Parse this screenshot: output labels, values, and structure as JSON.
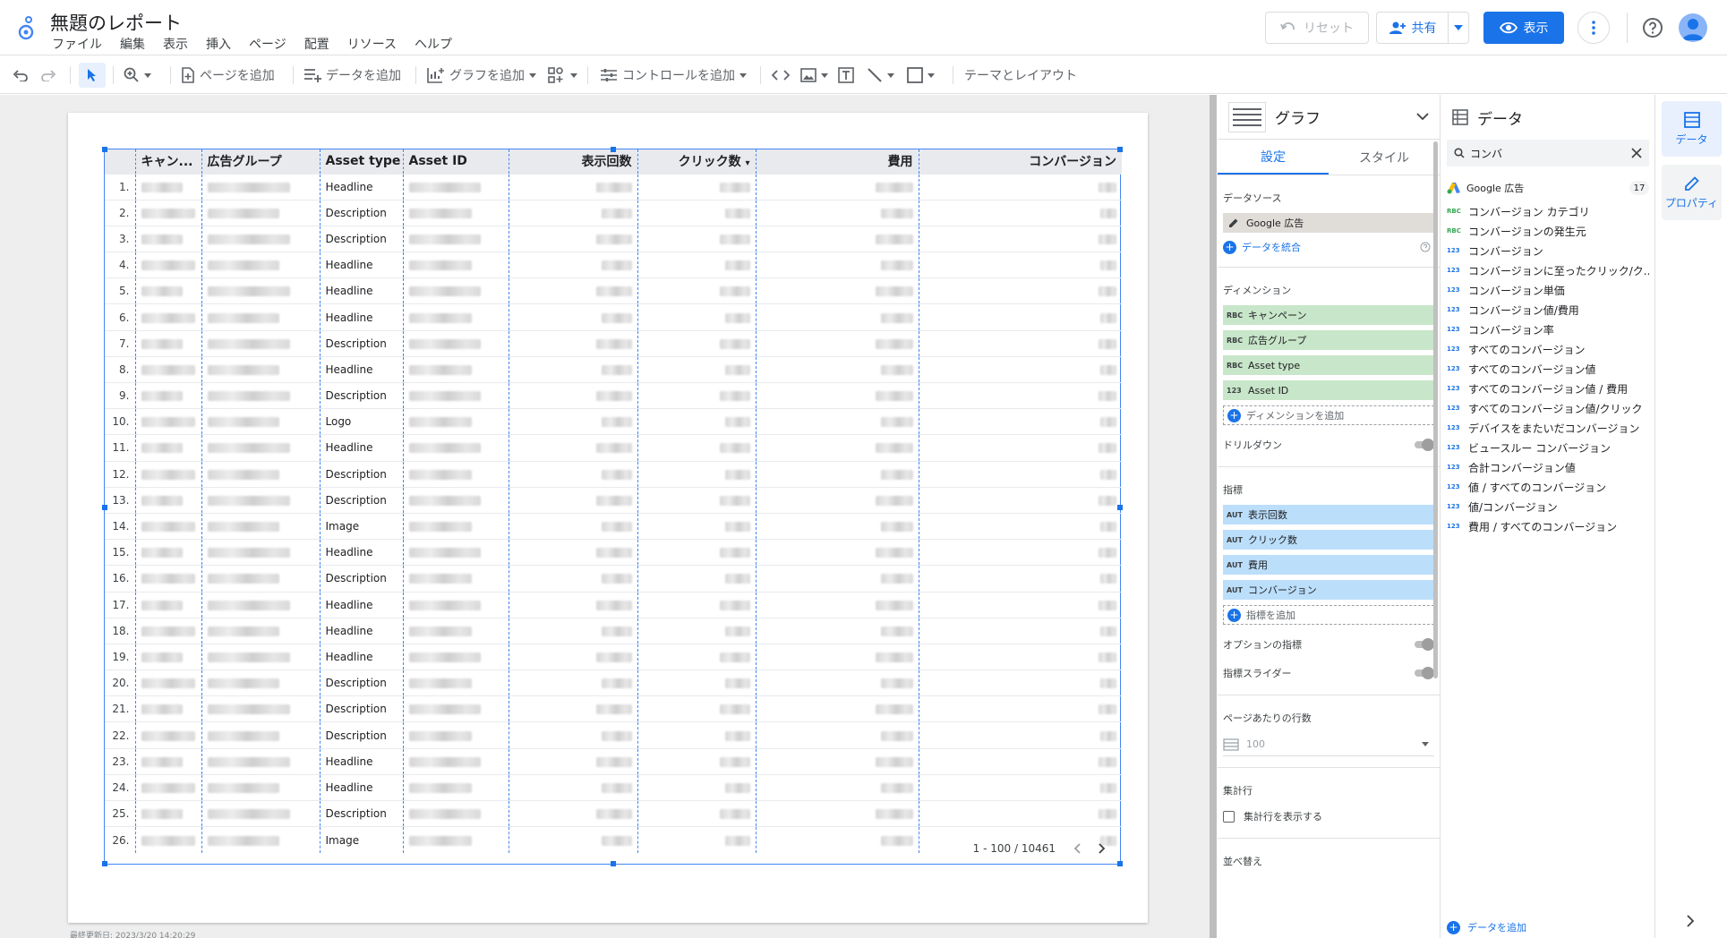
{
  "header": {
    "title": "無題のレポート",
    "menu": [
      "ファイル",
      "編集",
      "表示",
      "挿入",
      "ページ",
      "配置",
      "リソース",
      "ヘルプ"
    ],
    "reset_label": "リセット",
    "share_label": "共有",
    "view_label": "表示"
  },
  "toolbar": {
    "add_page": "ページを追加",
    "add_data": "データを追加",
    "add_chart": "グラフを追加",
    "add_control": "コントロールを追加",
    "theme_layout": "テーマとレイアウト"
  },
  "canvas": {
    "last_updated": "最終更新日: 2023/3/20 14:20:29"
  },
  "table": {
    "columns": [
      "キャン...",
      "広告グループ",
      "Asset type",
      "Asset ID",
      "表示回数",
      "クリック数",
      "費用",
      "コンバージョン"
    ],
    "sort_indicator": "▾",
    "rows": [
      {
        "index": "1.",
        "asset_type": "Headline"
      },
      {
        "index": "2.",
        "asset_type": "Description"
      },
      {
        "index": "3.",
        "asset_type": "Description"
      },
      {
        "index": "4.",
        "asset_type": "Headline"
      },
      {
        "index": "5.",
        "asset_type": "Headline"
      },
      {
        "index": "6.",
        "asset_type": "Headline"
      },
      {
        "index": "7.",
        "asset_type": "Description"
      },
      {
        "index": "8.",
        "asset_type": "Headline"
      },
      {
        "index": "9.",
        "asset_type": "Description"
      },
      {
        "index": "10.",
        "asset_type": "Logo"
      },
      {
        "index": "11.",
        "asset_type": "Headline"
      },
      {
        "index": "12.",
        "asset_type": "Description"
      },
      {
        "index": "13.",
        "asset_type": "Description"
      },
      {
        "index": "14.",
        "asset_type": "Image"
      },
      {
        "index": "15.",
        "asset_type": "Headline"
      },
      {
        "index": "16.",
        "asset_type": "Description"
      },
      {
        "index": "17.",
        "asset_type": "Headline"
      },
      {
        "index": "18.",
        "asset_type": "Headline"
      },
      {
        "index": "19.",
        "asset_type": "Headline"
      },
      {
        "index": "20.",
        "asset_type": "Description"
      },
      {
        "index": "21.",
        "asset_type": "Description"
      },
      {
        "index": "22.",
        "asset_type": "Description"
      },
      {
        "index": "23.",
        "asset_type": "Headline"
      },
      {
        "index": "24.",
        "asset_type": "Headline"
      },
      {
        "index": "25.",
        "asset_type": "Description"
      },
      {
        "index": "26.",
        "asset_type": "Image"
      }
    ],
    "pagination": "1 - 100 / 10461"
  },
  "chart_panel": {
    "title": "グラフ",
    "tabs": [
      "設定",
      "スタイル"
    ],
    "data_source_label": "データソース",
    "data_source": "Google 広告",
    "blend_data": "データを統合",
    "dimension_label": "ディメンション",
    "dimensions": [
      {
        "type": "RBC",
        "name": "キャンペーン"
      },
      {
        "type": "RBC",
        "name": "広告グループ"
      },
      {
        "type": "RBC",
        "name": "Asset type"
      },
      {
        "type": "123",
        "name": "Asset ID"
      }
    ],
    "add_dimension": "ディメンションを追加",
    "drilldown": "ドリルダウン",
    "metric_label": "指標",
    "metrics": [
      {
        "type": "AUT",
        "name": "表示回数"
      },
      {
        "type": "AUT",
        "name": "クリック数"
      },
      {
        "type": "AUT",
        "name": "費用"
      },
      {
        "type": "AUT",
        "name": "コンバージョン"
      }
    ],
    "add_metric": "指標を追加",
    "optional_metrics": "オプションの指標",
    "metric_slider": "指標スライダー",
    "rows_per_page_label": "ページあたりの行数",
    "rows_per_page": "100",
    "summary_label": "集計行",
    "show_summary": "集計行を表示する",
    "sort_label": "並べ替え"
  },
  "data_panel": {
    "title": "データ",
    "search_value": "コンバ",
    "source": "Google 広告",
    "count": "17",
    "fields": [
      {
        "type": "RBC",
        "name": "コンバージョン カテゴリ"
      },
      {
        "type": "RBC",
        "name": "コンバージョンの発生元"
      },
      {
        "type": "123",
        "name": "コンバージョン"
      },
      {
        "type": "123",
        "name": "コンバージョンに至ったクリック/ク..."
      },
      {
        "type": "123",
        "name": "コンバージョン単価"
      },
      {
        "type": "123",
        "name": "コンバージョン値/費用"
      },
      {
        "type": "123",
        "name": "コンバージョン率"
      },
      {
        "type": "123",
        "name": "すべてのコンバージョン"
      },
      {
        "type": "123",
        "name": "すべてのコンバージョン値"
      },
      {
        "type": "123",
        "name": "すべてのコンバージョン値 / 費用"
      },
      {
        "type": "123",
        "name": "すべてのコンバージョン値/クリック"
      },
      {
        "type": "123",
        "name": "デバイスをまたいだコンバージョン"
      },
      {
        "type": "123",
        "name": "ビュースルー コンバージョン"
      },
      {
        "type": "123",
        "name": "合計コンバージョン値"
      },
      {
        "type": "123",
        "name": "値 / すべてのコンバージョン"
      },
      {
        "type": "123",
        "name": "値/コンバージョン"
      },
      {
        "type": "123",
        "name": "費用 / すべてのコンバージョン"
      }
    ],
    "add_data": "データを追加"
  },
  "rail": {
    "data_label": "データ",
    "properties_label": "プロパティ"
  },
  "colors": {
    "accent": "#1a73e8",
    "dimension_chip": "#c8e6c9",
    "metric_chip": "#bbdefb"
  }
}
